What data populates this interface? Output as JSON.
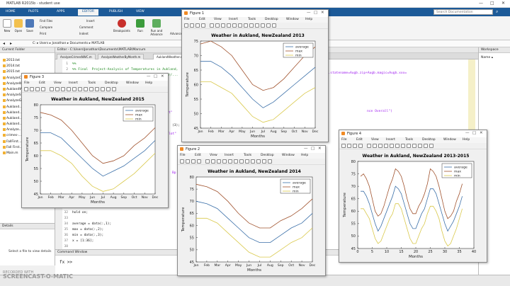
{
  "window": {
    "title": "MATLAB R2015b - student use"
  },
  "ribbon": {
    "tabs": [
      "HOME",
      "PLOTS",
      "APPS",
      "EDITOR",
      "PUBLISH",
      "VIEW"
    ],
    "active_tab": "EDITOR",
    "search_placeholder": "Search Documentation",
    "buttons": {
      "new": "New",
      "open": "Open",
      "save": "Save",
      "find_files": "Find Files",
      "compare": "Compare",
      "print": "Print",
      "insert": "Insert",
      "comment": "Comment",
      "indent": "Indent",
      "breakpoints": "Breakpoints",
      "run": "Run",
      "run_and_advance": "Run and Advance",
      "advance": "Advance"
    }
  },
  "path_bar": {
    "path": "C: ▸ Users ▸ Jonathan ▸ Documents ▸ MATLAB"
  },
  "current_folder": {
    "title": "Current Folder",
    "files": [
      "2013.txt",
      "2014.txt",
      "2015.txt",
      "AnalyzeCrimesNorthCar...",
      "AnalyzeWeatherByMonth.m",
      "AuklandWeather.m",
      "AnalyzeStu...",
      "AnalyzeGr...",
      "Aukland...",
      "Aukland...",
      "Aukland...",
      "Aukland...",
      "Analyze...",
      "crimes-...",
      "FallFirst...",
      "Fall First...",
      "Main.m"
    ]
  },
  "details": {
    "title": "Details",
    "message": "Select a file to view details"
  },
  "editor": {
    "header": "Editor - C:\\Users\\Jonathan\\Documents\\MATLAB\\Marcum",
    "tabs": [
      "AnalyzeCrimesNWC.m",
      "AnalyzeWeatherByMonth.m",
      "AuklandWeather.m"
    ],
    "lines": [
      {
        "num": "1",
        "text": "%%"
      },
      {
        "num": "2",
        "text": "%% Final  Project-Analysis of Temperatures in Aukland,"
      },
      {
        "num": "3",
        "text": "%% Data Source: http://www.weatherbase.com/weather/..."
      },
      {
        "num": "32",
        "text": "hold on;"
      },
      {
        "num": "33",
        "text": ""
      },
      {
        "num": "34",
        "text": "average = data(:,1);"
      },
      {
        "num": "35",
        "text": "max = data(:,2);"
      },
      {
        "num": "36",
        "text": "min = data(:,3);"
      },
      {
        "num": "37",
        "text": "x = [1:36];"
      },
      {
        "num": "38",
        "text": ""
      },
      {
        "num": "39",
        "text": "title('Weather in Aukland, NewZealand 2013');"
      }
    ],
    "url_fragment": "...statename=Augb.zip+Augb.magic=Augb.xxx=",
    "right_fragment": "nce Overall\")",
    "side_fragments": [
      "(3);",
      "t\"",
      "lot\"",
      "Bp"
    ]
  },
  "command_window": {
    "title": "Command Window",
    "prompt": "fx >>"
  },
  "workspace": {
    "title": "Workspace",
    "name_col": "Name ▴"
  },
  "watermark": {
    "line1": "RECORDED WITH",
    "line2": "SCREENCAST-O-MATIC"
  },
  "figures": [
    {
      "window_title": "Figure 1",
      "menu": [
        "File",
        "Edit",
        "View",
        "Insert",
        "Tools",
        "Desktop",
        "Window",
        "Help"
      ],
      "chart_data": {
        "type": "line",
        "title": "Weather in Aukland, NewZealand 2013",
        "xlabel": "Months",
        "ylabel": "Temperature",
        "categories": [
          "Jan",
          "Feb",
          "Mar",
          "Apr",
          "May",
          "Jun",
          "Jul",
          "Aug",
          "Sep",
          "Oct",
          "Nov",
          "Dec"
        ],
        "ylim": [
          45,
          75
        ],
        "yticks": [
          45,
          50,
          55,
          60,
          65,
          70,
          75
        ],
        "legend_placement": "top-right",
        "series": [
          {
            "name": "average",
            "color": "#3a6fa8",
            "values": [
              68,
              68,
              66,
              63,
              59,
              55,
              52,
              54,
              57,
              60,
              63,
              66
            ]
          },
          {
            "name": "max",
            "color": "#a0522d",
            "values": [
              74,
              75,
              73,
              70,
              65,
              60,
              58,
              59,
              62,
              66,
              70,
              73
            ]
          },
          {
            "name": "min",
            "color": "#d9c84a",
            "values": [
              61,
              61,
              59,
              57,
              53,
              49,
              47,
              48,
              51,
              54,
              57,
              59
            ]
          }
        ]
      }
    },
    {
      "window_title": "Figure 3",
      "menu": [
        "File",
        "Edit",
        "View",
        "Insert",
        "Tools",
        "Desktop",
        "Window",
        "Help"
      ],
      "chart_data": {
        "type": "line",
        "title": "Weather in Aukland, NewZealand 2015",
        "xlabel": "Months",
        "ylabel": "Temperature",
        "categories": [
          "Jan",
          "Feb",
          "Mar",
          "Apr",
          "May",
          "Jun",
          "Jul",
          "Aug",
          "Sep",
          "Oct",
          "Nov",
          "Dec"
        ],
        "ylim": [
          45,
          80
        ],
        "yticks": [
          45,
          50,
          55,
          60,
          65,
          70,
          75,
          80
        ],
        "legend_placement": "top-right",
        "series": [
          {
            "name": "average",
            "color": "#3a6fa8",
            "values": [
              69,
              69,
              67,
              63,
              59,
              55,
              52,
              54,
              56,
              59,
              62,
              66
            ]
          },
          {
            "name": "max",
            "color": "#a0522d",
            "values": [
              77,
              76,
              74,
              70,
              65,
              60,
              57,
              58,
              60,
              64,
              67,
              71
            ]
          },
          {
            "name": "min",
            "color": "#d9c84a",
            "values": [
              62,
              62,
              60,
              57,
              52,
              48,
              46,
              47,
              50,
              53,
              57,
              61
            ]
          }
        ]
      }
    },
    {
      "window_title": "Figure 2",
      "menu": [
        "File",
        "Edit",
        "View",
        "Insert",
        "Tools",
        "Desktop",
        "Window",
        "Help"
      ],
      "chart_data": {
        "type": "line",
        "title": "Weather in Aukland, NewZealand 2014",
        "xlabel": "Months",
        "ylabel": "Temperature",
        "categories": [
          "Jan",
          "Feb",
          "Mar",
          "Apr",
          "May",
          "Jun",
          "Jul",
          "Aug",
          "Sep",
          "Oct",
          "Nov",
          "Dec"
        ],
        "ylim": [
          45,
          80
        ],
        "yticks": [
          45,
          50,
          55,
          60,
          65,
          70,
          75,
          80
        ],
        "legend_placement": "top-right",
        "series": [
          {
            "name": "average",
            "color": "#3a6fa8",
            "values": [
              70,
              69,
              67,
              63,
              59,
              55,
              53,
              53,
              56,
              59,
              61,
              65
            ]
          },
          {
            "name": "max",
            "color": "#a0522d",
            "values": [
              77,
              76,
              74,
              70,
              65,
              61,
              59,
              59,
              62,
              64,
              67,
              71
            ]
          },
          {
            "name": "min",
            "color": "#d9c84a",
            "values": [
              63,
              63,
              61,
              57,
              53,
              49,
              47,
              47,
              50,
              53,
              55,
              59
            ]
          }
        ]
      }
    },
    {
      "window_title": "Figure 4",
      "menu": [
        "File",
        "Edit",
        "View",
        "Insert",
        "Tools",
        "Desktop",
        "Window",
        "Help"
      ],
      "chart_data": {
        "type": "line",
        "title": "Weather in Aukland, NewZealand 2013-2015",
        "xlabel": "Months",
        "ylabel": "Temperature",
        "xlim": [
          0,
          40
        ],
        "xticks": [
          0,
          5,
          10,
          15,
          20,
          25,
          30,
          35,
          40
        ],
        "ylim": [
          45,
          80
        ],
        "yticks": [
          45,
          50,
          55,
          60,
          65,
          70,
          75,
          80
        ],
        "legend_placement": "top-right",
        "series": [
          {
            "name": "average",
            "color": "#3a6fa8",
            "values": [
              68,
              68,
              66,
              63,
              59,
              55,
              52,
              54,
              57,
              60,
              63,
              66,
              70,
              69,
              67,
              63,
              59,
              55,
              53,
              53,
              56,
              59,
              61,
              65,
              69,
              69,
              67,
              63,
              59,
              55,
              52,
              54,
              56,
              59,
              62,
              66
            ]
          },
          {
            "name": "max",
            "color": "#a0522d",
            "values": [
              74,
              75,
              73,
              70,
              65,
              60,
              58,
              59,
              62,
              66,
              70,
              73,
              77,
              76,
              74,
              70,
              65,
              61,
              59,
              59,
              62,
              64,
              67,
              71,
              77,
              76,
              74,
              70,
              65,
              60,
              57,
              58,
              60,
              64,
              67,
              71
            ]
          },
          {
            "name": "min",
            "color": "#d9c84a",
            "values": [
              61,
              61,
              59,
              57,
              53,
              49,
              47,
              48,
              51,
              54,
              57,
              59,
              63,
              63,
              61,
              57,
              53,
              49,
              47,
              47,
              50,
              53,
              55,
              59,
              62,
              62,
              60,
              57,
              52,
              48,
              46,
              47,
              50,
              53,
              57,
              61
            ]
          }
        ]
      }
    }
  ]
}
